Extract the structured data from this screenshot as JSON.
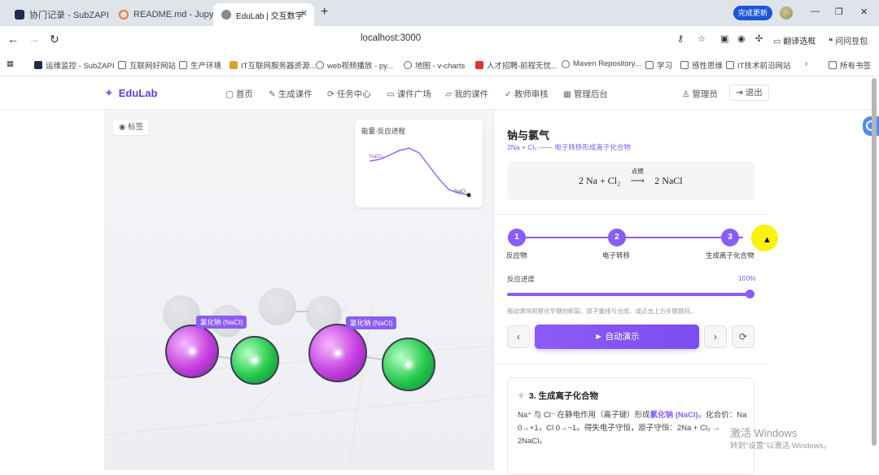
{
  "browser": {
    "tabs": [
      {
        "label": "协门记录 - SubZAPI",
        "icon_color": "#1e2b4a"
      },
      {
        "label": "README.md - Jupyter",
        "icon_color": "#f37626"
      },
      {
        "label": "EduLab | 交互数字",
        "icon_color": "#888888"
      }
    ],
    "update_label": "完成更新",
    "url": "localhost:3000",
    "toolbar": {
      "translate": "翻译选框",
      "back_to_top": "问问豆包"
    },
    "bookmarks": [
      "运维监控 - SubZAPI",
      "互联网好网站",
      "生产环境",
      "IT互联网服务器资源...",
      "web视频播放 - py...",
      "地图 - v-charts",
      "人才招聘-前程无忧...",
      "Maven Repository...",
      "学习",
      "感性思维",
      "IT技术前沿网站",
      "所有书签"
    ]
  },
  "app": {
    "brand": "EduLab",
    "nav": [
      {
        "label": "首页",
        "icon": "home-icon",
        "glyph": "▢"
      },
      {
        "label": "生成课件",
        "icon": "wand-icon",
        "glyph": "✎"
      },
      {
        "label": "任务中心",
        "icon": "refresh-icon",
        "glyph": "⟳"
      },
      {
        "label": "课件广场",
        "icon": "book-icon",
        "glyph": "▭"
      },
      {
        "label": "我的课件",
        "icon": "folder-icon",
        "glyph": "▱"
      },
      {
        "label": "教师审核",
        "icon": "check-icon",
        "glyph": "✓"
      },
      {
        "label": "管理后台",
        "icon": "grid-icon",
        "glyph": "▦"
      }
    ],
    "user_label": "管理员",
    "logout_label": "退出"
  },
  "scene": {
    "label_toggle": "标签",
    "energy_card": {
      "title": "能量-反应进程",
      "start_label": "NaCl₂",
      "end_label": "NaCl"
    },
    "molecule_tag": "氯化钠 (NaCl)",
    "colors": {
      "sodium": "#c53ee0",
      "chlorine": "#22c84a",
      "accent": "#8b5cf6"
    }
  },
  "chart_data": {
    "type": "line",
    "title": "能量-反应进程",
    "xlabel": "",
    "ylabel": "",
    "series": [
      {
        "values": [
          {
            "x": 0,
            "y": 0.6
          },
          {
            "x": 0.1,
            "y": 0.63
          },
          {
            "x": 0.2,
            "y": 0.7
          },
          {
            "x": 0.3,
            "y": 0.78
          },
          {
            "x": 0.4,
            "y": 0.82
          },
          {
            "x": 0.5,
            "y": 0.74
          },
          {
            "x": 0.6,
            "y": 0.52
          },
          {
            "x": 0.7,
            "y": 0.3
          },
          {
            "x": 0.8,
            "y": 0.12
          },
          {
            "x": 0.9,
            "y": 0.06
          },
          {
            "x": 1.0,
            "y": 0.03
          }
        ]
      }
    ],
    "grid": false,
    "legend": "none"
  },
  "panel": {
    "title": "钠与氯气",
    "subtitle": "2Na + Cl₂ —— 电子转移形成离子化合物",
    "equation": {
      "left": "2 Na + Cl₂",
      "condition": "点燃",
      "right": "2 NaCl"
    },
    "steps": [
      {
        "num": "1",
        "label": "反应物"
      },
      {
        "num": "2",
        "label": "电子转移"
      },
      {
        "num": "3",
        "label": "生成离子化合物"
      }
    ],
    "progress_label": "反应进度",
    "progress_value": "100%",
    "progress_fraction": 1.0,
    "hint": "拖动滑块观察化学键的断裂、原子重排与合成，或点击上方步骤跳转。",
    "play_label": "► 自动演示",
    "prev_glyph": "‹",
    "next_glyph": "›",
    "reset_glyph": "⟳",
    "desc_title": "3. 生成离子化合物",
    "desc_pre": "Na⁺ 与 Cl⁻ 在静电作用（离子键）形成",
    "desc_highlight": "氯化钠 (NaCl)",
    "desc_post": "。化合价：Na 0→+1，Cl 0→−1。得失电子守恒，原子守恒：2Na + Cl₂ → 2NaCl。"
  },
  "os": {
    "watermark": "激活 Windows",
    "watermark_sub": "转到\"设置\"以激活 Windows。"
  }
}
